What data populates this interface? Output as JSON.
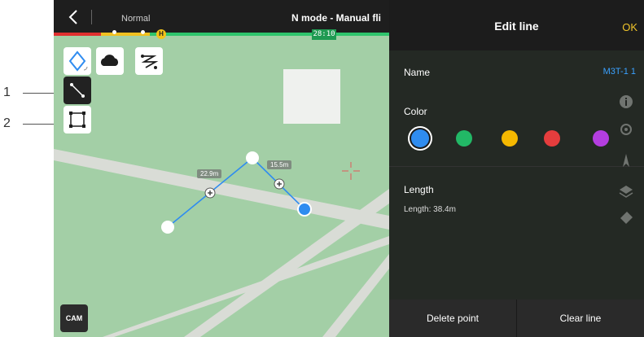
{
  "callouts": [
    "1",
    "2"
  ],
  "topbar": {
    "mode": "Normal",
    "title": "N mode - Manual fli",
    "home_marker": "H",
    "timer": "28:10"
  },
  "tools": {
    "top": [
      "waypoint-icon",
      "area-cloud-icon",
      "route-icon"
    ],
    "left": [
      "line-icon",
      "polygon-icon"
    ]
  },
  "map": {
    "segment_labels": [
      "22.9m",
      "15.5m"
    ],
    "cam_label": "CAM"
  },
  "panel": {
    "title": "Edit line",
    "ok_label": "OK",
    "name_label": "Name",
    "name_value": "M3T-1 1",
    "color_label": "Color",
    "colors": [
      "#2f8cf0",
      "#22b866",
      "#f5b800",
      "#e53d3d",
      "#b43ee0"
    ],
    "selected_color": "#2f8cf0",
    "length_label": "Length",
    "length_value": "Length: 38.4m",
    "delete_point_label": "Delete point",
    "clear_line_label": "Clear line"
  }
}
